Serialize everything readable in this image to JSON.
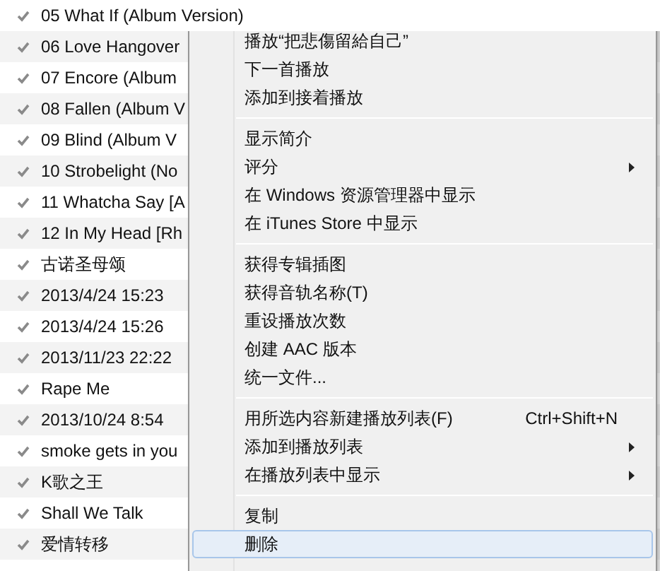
{
  "songs": [
    {
      "title": "05 What If (Album Version)",
      "checked": true
    },
    {
      "title": "06 Love Hangover",
      "checked": true
    },
    {
      "title": "07 Encore (Album",
      "checked": true
    },
    {
      "title": "08 Fallen (Album V",
      "checked": true
    },
    {
      "title": "09 Blind (Album V",
      "checked": true
    },
    {
      "title": "10 Strobelight (No",
      "checked": true
    },
    {
      "title": "11 Whatcha Say [A",
      "checked": true
    },
    {
      "title": "12 In My Head [Rh",
      "checked": true
    },
    {
      "title": "古诺圣母颂",
      "checked": true
    },
    {
      "title": "2013/4/24 15:23",
      "checked": true
    },
    {
      "title": "2013/4/24 15:26",
      "checked": true
    },
    {
      "title": "2013/11/23 22:22",
      "checked": true
    },
    {
      "title": "Rape Me",
      "checked": true
    },
    {
      "title": "2013/10/24 8:54",
      "checked": true
    },
    {
      "title": "smoke gets in you",
      "checked": true
    },
    {
      "title": "K歌之王",
      "checked": true
    },
    {
      "title": "Shall We Talk",
      "checked": true
    },
    {
      "title": "爱情转移",
      "checked": true
    }
  ],
  "context_menu": [
    {
      "kind": "item",
      "label": "播放“把悲傷留給自己”",
      "submenu": false,
      "selected": false
    },
    {
      "kind": "item",
      "label": "下一首播放",
      "submenu": false,
      "selected": false
    },
    {
      "kind": "item",
      "label": "添加到接着播放",
      "submenu": false,
      "selected": false
    },
    {
      "kind": "separator"
    },
    {
      "kind": "item",
      "label": "显示简介",
      "submenu": false,
      "selected": false
    },
    {
      "kind": "item",
      "label": "评分",
      "submenu": true,
      "selected": false
    },
    {
      "kind": "item",
      "label": "在 Windows 资源管理器中显示",
      "submenu": false,
      "selected": false
    },
    {
      "kind": "item",
      "label": "在 iTunes Store 中显示",
      "submenu": false,
      "selected": false
    },
    {
      "kind": "separator"
    },
    {
      "kind": "item",
      "label": "获得专辑插图",
      "submenu": false,
      "selected": false
    },
    {
      "kind": "item",
      "label": "获得音轨名称(T)",
      "submenu": false,
      "selected": false
    },
    {
      "kind": "item",
      "label": "重设播放次数",
      "submenu": false,
      "selected": false
    },
    {
      "kind": "item",
      "label": "创建 AAC 版本",
      "submenu": false,
      "selected": false
    },
    {
      "kind": "item",
      "label": "统一文件...",
      "submenu": false,
      "selected": false
    },
    {
      "kind": "separator"
    },
    {
      "kind": "item",
      "label": "用所选内容新建播放列表(F)",
      "shortcut": "Ctrl+Shift+N",
      "submenu": false,
      "selected": false
    },
    {
      "kind": "item",
      "label": "添加到播放列表",
      "submenu": true,
      "selected": false
    },
    {
      "kind": "item",
      "label": "在播放列表中显示",
      "submenu": true,
      "selected": false
    },
    {
      "kind": "separator"
    },
    {
      "kind": "item",
      "label": "复制",
      "submenu": false,
      "selected": false
    },
    {
      "kind": "item",
      "label": "删除",
      "submenu": false,
      "selected": true
    }
  ]
}
